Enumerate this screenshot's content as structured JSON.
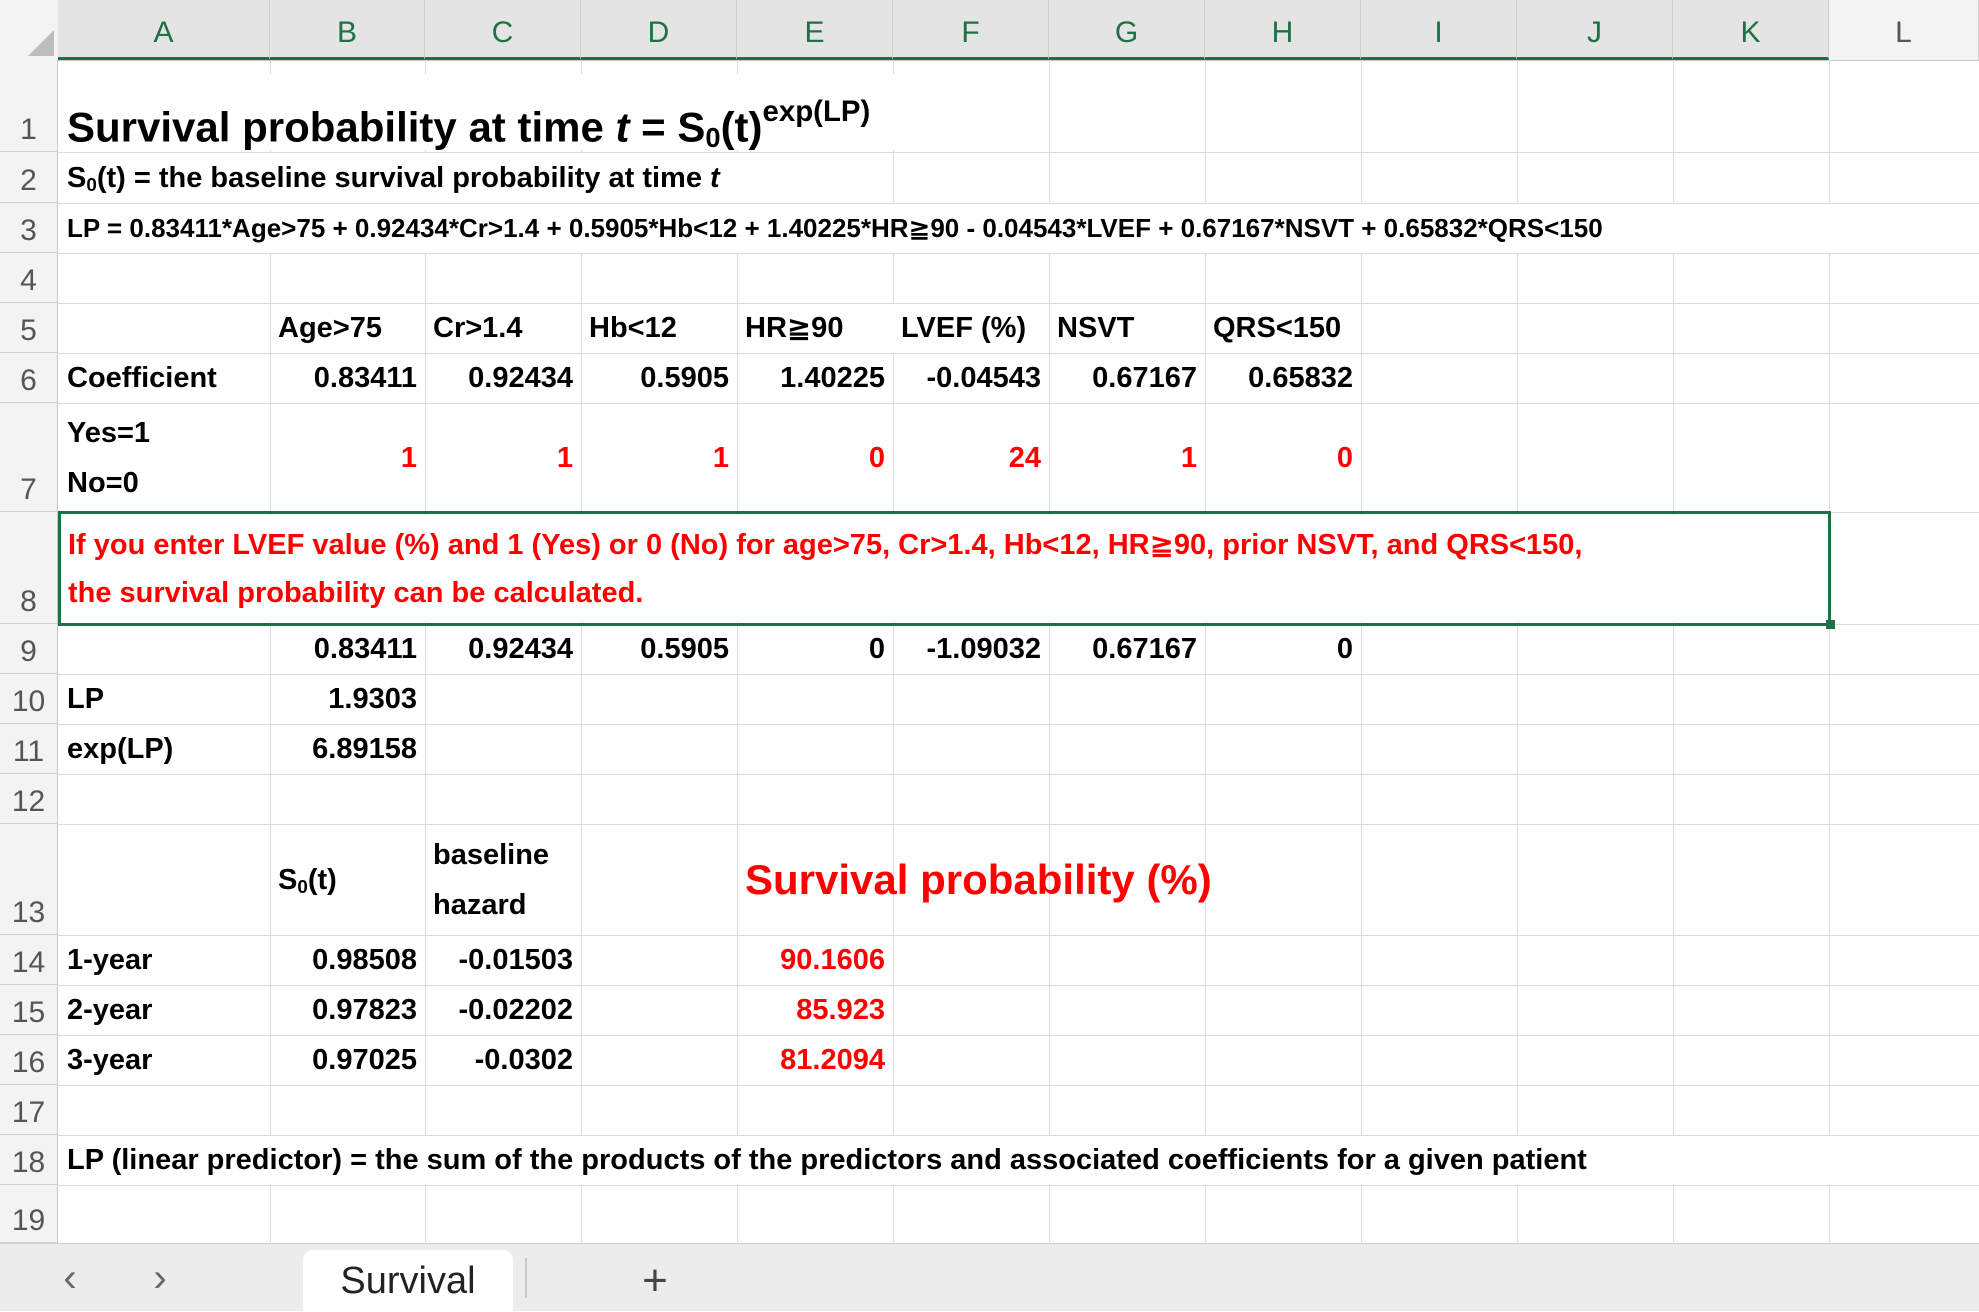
{
  "columns": [
    "A",
    "B",
    "C",
    "D",
    "E",
    "F",
    "G",
    "H",
    "I",
    "J",
    "K",
    "L"
  ],
  "rows": [
    "1",
    "2",
    "3",
    "4",
    "5",
    "6",
    "7",
    "8",
    "9",
    "10",
    "11",
    "12",
    "13",
    "14",
    "15",
    "16",
    "17",
    "18",
    "19"
  ],
  "title": {
    "prefix": "Survival probability at time ",
    "t": "t",
    "eq": " = S",
    "sub0": "0",
    "paren_t": "(t)",
    "exp": "exp(LP)"
  },
  "row2": {
    "s": "S",
    "sub": "0",
    "rest": "(t) = the baseline survival probability at time ",
    "t": "t"
  },
  "row3": "LP = 0.83411*Age>75 + 0.92434*Cr>1.4 + 0.5905*Hb<12 + 1.40225*HR≧90 - 0.04543*LVEF + 0.67167*NSVT + 0.65832*QRS<150",
  "headers": [
    "Age>75",
    "Cr>1.4",
    "Hb<12",
    "HR≧90",
    "LVEF (%)",
    "NSVT",
    "QRS<150"
  ],
  "coefficient": {
    "label": "Coefficient",
    "values": [
      "0.83411",
      "0.92434",
      "0.5905",
      "1.40225",
      "-0.04543",
      "0.67167",
      "0.65832"
    ]
  },
  "inputs": {
    "label_yes": "Yes=1",
    "label_no": "No=0",
    "values": [
      "1",
      "1",
      "1",
      "0",
      "24",
      "1",
      "0"
    ]
  },
  "instruction": {
    "line1": "If you enter LVEF value (%) and 1 (Yes) or 0 (No) for age>75, Cr>1.4, Hb<12, HR≧90, prior NSVT, and QRS<150,",
    "line2": "the survival probability can be calculated."
  },
  "products": [
    "0.83411",
    "0.92434",
    "0.5905",
    "0",
    "-1.09032",
    "0.67167",
    "0"
  ],
  "lp": {
    "label": "LP",
    "value": "1.9303"
  },
  "explp": {
    "label": "exp(LP)",
    "value": "6.89158"
  },
  "table": {
    "s0": "S",
    "s0_sub": "0",
    "s0_rest": "(t)",
    "baseline_line1": "baseline",
    "baseline_line2": "hazard",
    "survival_header": "Survival probability (%)",
    "rows": [
      {
        "label": "1-year",
        "s0": "0.98508",
        "hazard": "-0.01503",
        "survival": "90.1606"
      },
      {
        "label": "2-year",
        "s0": "0.97823",
        "hazard": "-0.02202",
        "survival": "85.923"
      },
      {
        "label": "3-year",
        "s0": "0.97025",
        "hazard": "-0.0302",
        "survival": "81.2094"
      }
    ]
  },
  "row18": "LP (linear predictor) = the sum of the products of the predictors and associated coefficients for a given patient",
  "tabs": {
    "sheet_name": "Survival",
    "add_label": "+",
    "prev": "‹",
    "next": "›"
  },
  "colors": {
    "accent": "#1e7145",
    "red": "#ff0000"
  }
}
